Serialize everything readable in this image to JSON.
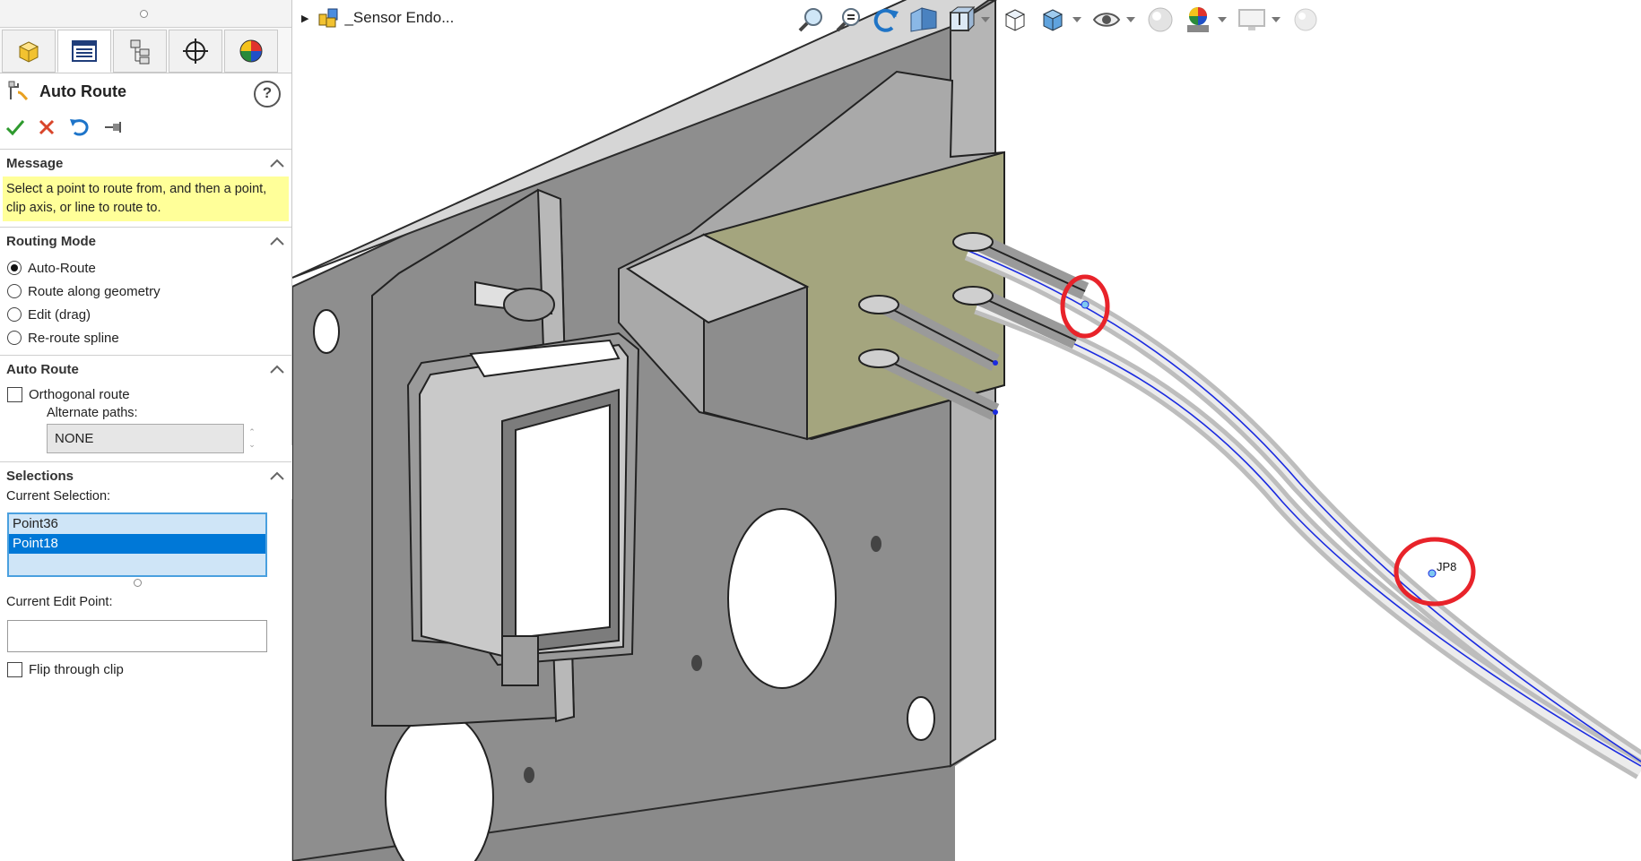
{
  "feature": {
    "title": "Auto Route",
    "help_glyph": "?"
  },
  "tabs": [
    {
      "icon": "part-icon"
    },
    {
      "icon": "property-manager-icon"
    },
    {
      "icon": "configuration-manager-icon"
    },
    {
      "icon": "dimxpert-icon"
    },
    {
      "icon": "display-manager-icon"
    }
  ],
  "sections": {
    "message": {
      "header": "Message",
      "text": "Select a point to route from, and then a point, clip axis, or line to route to."
    },
    "routing_mode": {
      "header": "Routing Mode",
      "options": [
        "Auto-Route",
        "Route along geometry",
        "Edit (drag)",
        "Re-route spline"
      ],
      "selected": "Auto-Route"
    },
    "auto_route": {
      "header": "Auto Route",
      "orthogonal_label": "Orthogonal route",
      "alternate_paths_label": "Alternate paths:",
      "alternate_paths_value": "NONE"
    },
    "selections": {
      "header": "Selections",
      "current_selection_label": "Current Selection:",
      "items": [
        "Point36",
        "Point18"
      ],
      "selected_item": "Point18",
      "current_edit_point_label": "Current Edit Point:",
      "current_edit_point_value": "",
      "flip_label": "Flip through clip"
    }
  },
  "viewport": {
    "tree_item": "_Sensor Endo...",
    "annotation_label": "JP8",
    "colors": {
      "highlight_circle": "#e8232a",
      "route_line": "#1b2be0",
      "plate": "#8c8c8c",
      "connector_face": "#a5a37c"
    }
  }
}
